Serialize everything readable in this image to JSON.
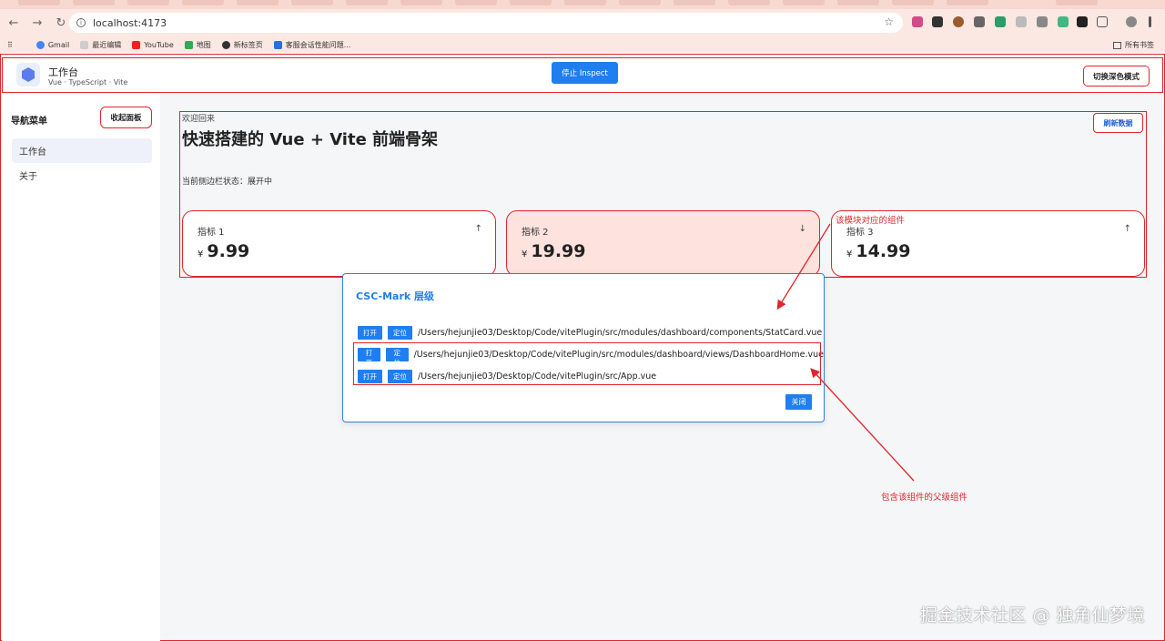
{
  "browser": {
    "url": "localhost:4173",
    "bookmarks": [
      "Gmail",
      "最近编辑",
      "YouTube",
      "地图",
      "新标签页",
      "客服会话性能问题..."
    ],
    "all_bookmarks": "所有书签"
  },
  "app": {
    "title": "工作台",
    "subtitle": "Vue · TypeScript · Vite",
    "inspect_button": "停止 Inspect",
    "dark_mode_button": "切换深色模式"
  },
  "sidebar": {
    "title": "导航菜单",
    "collapse_button": "收起面板",
    "items": [
      {
        "label": "工作台",
        "active": true
      },
      {
        "label": "关于",
        "active": false
      }
    ]
  },
  "main": {
    "welcome": "欢迎回来",
    "headline": "快速搭建的 Vue + Vite 前端骨架",
    "refresh_button": "刷新数据",
    "sidebar_status": "当前侧边栏状态：展开中",
    "stats": [
      {
        "label": "指标 1",
        "currency": "¥",
        "value": "9.99",
        "trend": "↑"
      },
      {
        "label": "指标 2",
        "currency": "¥",
        "value": "19.99",
        "trend": "↓"
      },
      {
        "label": "指标 3",
        "currency": "¥",
        "value": "14.99",
        "trend": "↑"
      }
    ]
  },
  "dialog": {
    "title": "CSC-Mark 层级",
    "open_label": "打开",
    "locate_label": "定位",
    "paths": [
      "/Users/hejunjie03/Desktop/Code/vitePlugin/src/modules/dashboard/components/StatCard.vue",
      "/Users/hejunjie03/Desktop/Code/vitePlugin/src/modules/dashboard/views/DashboardHome.vue",
      "/Users/hejunjie03/Desktop/Code/vitePlugin/src/App.vue"
    ],
    "close_button": "关闭"
  },
  "annotations": {
    "component": "该模块对应的组件",
    "parent": "包含该组件的父级组件"
  },
  "watermark": "掘金技术社区 @ 独角仙梦境",
  "colors": {
    "accent": "#1f7ff0",
    "annotation": "#e0252b",
    "warn_card": "#fde2de"
  }
}
